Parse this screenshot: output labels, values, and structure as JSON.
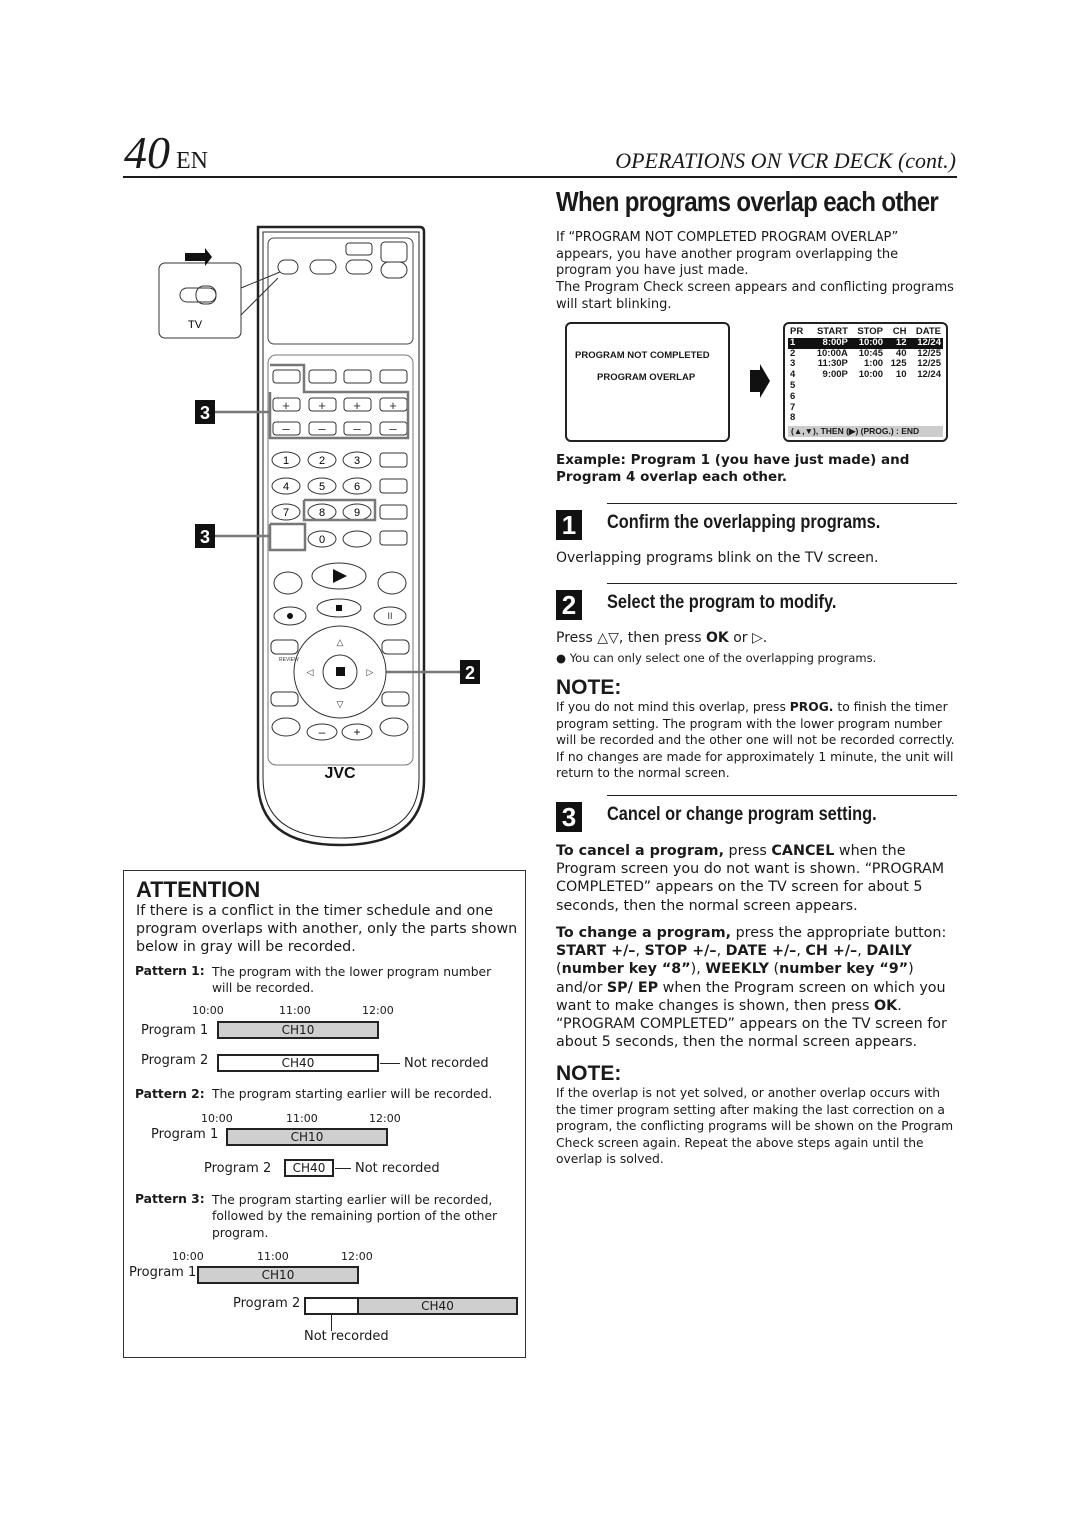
{
  "header": {
    "page_number": "40",
    "lang": "EN",
    "section": "OPERATIONS ON VCR DECK (cont.)"
  },
  "title": "When programs overlap each other",
  "intro": [
    "If “PROGRAM NOT COMPLETED PROGRAM OVERLAP” appears, you have another program overlapping the program you have just made.",
    "The Program Check screen appears and conflicting programs will start blinking."
  ],
  "screen1": {
    "line1": "PROGRAM NOT COMPLETED",
    "line2": "PROGRAM OVERLAP"
  },
  "screen2": {
    "headers": [
      "PR",
      "START",
      "STOP",
      "CH",
      "DATE"
    ],
    "rows": [
      [
        "1",
        "8:00P",
        "10:00",
        "12",
        "12/24"
      ],
      [
        "2",
        "10:00A",
        "10:45",
        "40",
        "12/25"
      ],
      [
        "3",
        "11:30P",
        "1:00",
        "125",
        "12/25"
      ],
      [
        "4",
        "9:00P",
        "10:00",
        "10",
        "12/24"
      ],
      [
        "5",
        "",
        "",
        "",
        ""
      ],
      [
        "6",
        "",
        "",
        "",
        ""
      ],
      [
        "7",
        "",
        "",
        "",
        ""
      ],
      [
        "8",
        "",
        "",
        "",
        ""
      ]
    ],
    "footer": "(▲,▼), THEN (▶)  (PROG.) : END"
  },
  "example": "Example: Program 1 (you have just made) and Program 4 overlap each other.",
  "steps": [
    {
      "num": "1",
      "heading": "Confirm the overlapping programs.",
      "body": "Overlapping programs blink on the TV screen."
    },
    {
      "num": "2",
      "heading": "Select the program to modify.",
      "body_pre": "Press △▽, then press ",
      "body_ok": "OK",
      "body_post": " or ▷.",
      "bullet": "● You can only select one of the overlapping programs."
    },
    {
      "num": "3",
      "heading": "Cancel or change program setting."
    }
  ],
  "note1": {
    "title": "NOTE:",
    "pre": "If you do not mind this overlap, press ",
    "bold": "PROG.",
    "post": " to finish the timer program setting. The program with the lower program number will be recorded and the other one will not be recorded correctly. If no changes are made for approximately 1 minute, the unit will return to the normal screen."
  },
  "cancel": {
    "lead": "To cancel a program,",
    "t1": " press ",
    "b1": "CANCEL",
    "t2": " when the Program screen you do not want is shown. “PROGRAM COMPLETED” appears on the TV screen for about 5 seconds, then the normal screen appears."
  },
  "change": {
    "lead": "To change a program,",
    "t1": " press the appropriate button: ",
    "b1": "START +/–",
    "t2": ", ",
    "b2": "STOP +/–",
    "t3": ", ",
    "b3": "DATE +/–",
    "t4": ", ",
    "b4": "CH +/–",
    "t5": ", ",
    "b5": "DAILY",
    "t6": " (",
    "b6": "number key “8”",
    "t7": "), ",
    "b7": "WEEKLY",
    "t8": " (",
    "b8": "number key “9”",
    "t9": ") and/or ",
    "b9": "SP/ EP",
    "t10": " when the Program screen on which you want to make changes is shown, then press ",
    "b10": "OK",
    "t11": ". “PROGRAM COMPLETED” appears on the TV screen for about 5 seconds, then the normal screen appears."
  },
  "note2": {
    "title": "NOTE:",
    "text": "If the overlap is not yet solved, or another overlap occurs with the timer program setting after making the last correction on a program, the conflicting programs will be shown on the Program Check screen again. Repeat the above steps again until the overlap is solved."
  },
  "attention": {
    "title": "ATTENTION",
    "text": "If there is a conflict in the timer schedule and one program overlaps with another, only the parts shown below in gray will be recorded.",
    "times": [
      "10:00",
      "11:00",
      "12:00"
    ],
    "program1": "Program 1",
    "program2": "Program 2",
    "ch1": "CH10",
    "ch2": "CH40",
    "not_recorded": "Not recorded",
    "patterns": [
      {
        "label": "Pattern 1:",
        "text": "The program with the lower program number will be recorded."
      },
      {
        "label": "Pattern 2:",
        "text": "The program starting earlier will be recorded."
      },
      {
        "label": "Pattern 3:",
        "text": "The program starting earlier will be recorded, followed by the remaining portion of the other program."
      }
    ]
  },
  "remote": {
    "brand": "JVC",
    "switch_label": "TV",
    "keys": [
      "1",
      "2",
      "3",
      "4",
      "5",
      "6",
      "7",
      "8",
      "9",
      "0"
    ],
    "callouts": [
      "3",
      "3",
      "2"
    ],
    "mini_badges": [
      "1",
      "2",
      "3",
      "4"
    ],
    "recall_label": "REVIEW"
  }
}
